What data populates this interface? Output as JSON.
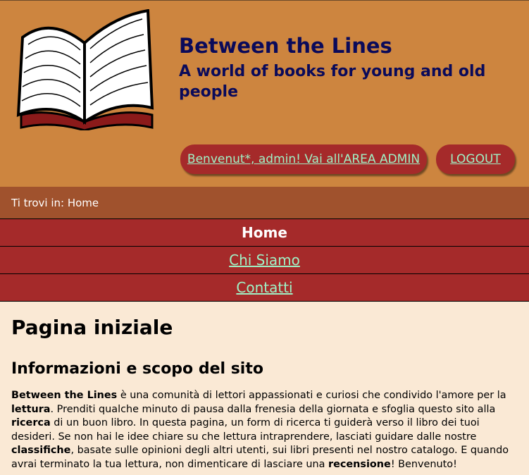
{
  "header": {
    "title": "Between the Lines",
    "subtitle": "A world of books for young and old people",
    "admin_button": "Benvenut*, admin! Vai all'AREA ADMIN",
    "logout_button": "LOGOUT"
  },
  "breadcrumb": {
    "text": "Ti trovi in: Home"
  },
  "nav": [
    {
      "label": "Home",
      "active": true
    },
    {
      "label": "Chi Siamo",
      "active": false
    },
    {
      "label": "Contatti",
      "active": false
    }
  ],
  "main": {
    "page_title": "Pagina iniziale",
    "section_title": "Informazioni e scopo del sito",
    "intro": [
      {
        "bold": "Between the Lines",
        "text": " è una comunità di lettori appassionati e curiosi che condivido l'amore per la "
      },
      {
        "bold": "lettura",
        "text": ". Prenditi qualche minuto di pausa dalla frenesia della giornata e sfoglia questo sito alla "
      },
      {
        "bold": "ricerca",
        "text": " di un buon libro. In questa pagina, un form di ricerca ti guiderà verso il libro dei tuoi desideri. Se non hai le idee chiare su che lettura intraprendere, lasciati guidare dalle nostre "
      },
      {
        "bold": "classifiche",
        "text": ", basate sulle opinioni degli altri utenti, sui libri presenti nel nostro catalogo. E quando avrai terminato la tua lettura, non dimenticare di lasciare una "
      },
      {
        "bold": "recensione",
        "text": "! Benvenuto!"
      }
    ]
  },
  "colors": {
    "header_bg": "#cd853f",
    "breadcrumb_bg": "#a0522d",
    "nav_bg": "#a52a2a",
    "link": "#9ff2c6",
    "title": "#0a0a5a",
    "page_bg": "#fae9d5"
  },
  "icons": {
    "logo": "open-book-logo"
  }
}
